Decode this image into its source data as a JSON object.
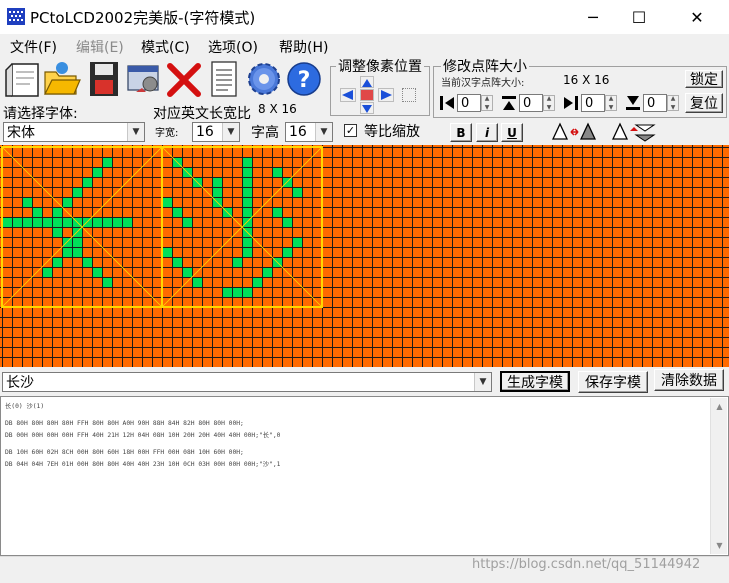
{
  "window": {
    "title": "PCtoLCD2002完美版-(字符模式)",
    "controls": {
      "minimize": "─",
      "maximize": "☐",
      "close": "✕"
    }
  },
  "menu": [
    {
      "label": "文件(F)",
      "enabled": true
    },
    {
      "label": "编辑(E)",
      "enabled": false
    },
    {
      "label": "模式(C)",
      "enabled": true
    },
    {
      "label": "选项(O)",
      "enabled": true
    },
    {
      "label": "帮助(H)",
      "enabled": true
    }
  ],
  "toolbar": {
    "icons": [
      "new-file-icon",
      "open-folder-icon",
      "save-disk-icon",
      "settings-window-icon",
      "delete-x-icon",
      "notepad-icon",
      "gear-icon",
      "help-icon"
    ]
  },
  "pixel_shift": {
    "title": "调整像素位置"
  },
  "matrix_size": {
    "title": "修改点阵大小",
    "current_label": "当前汉字点阵大小:",
    "current_value": "16 X 16",
    "lock_label": "锁定",
    "reset_label": "复位",
    "spinners": [
      "0",
      "0",
      "0",
      "0"
    ]
  },
  "font": {
    "select_label": "请选择字体:",
    "font_name": "宋体",
    "ratio_label": "对应英文长宽比",
    "ratio_value": "8 X 16",
    "width_label": "字宽:",
    "width_value": "16",
    "height_label": "字高",
    "height_value": "16",
    "proportional_label": "等比缩放",
    "proportional_checked": true,
    "bold_label": "B",
    "italic_label": "i",
    "underline_label": "U",
    "accent": "#ff6a00",
    "lit_color": "#00e05a",
    "frame_color": "#ffd800"
  },
  "input": {
    "text": "长沙",
    "generate_label": "生成字模",
    "save_label": "保存字模",
    "clear_label": "清除数据"
  },
  "output": {
    "lines": [
      "长(0) 沙(1)",
      "",
      "DB 80H 80H 80H 80H FFH 80H 80H A0H 90H 88H 84H 82H 80H 80H 00H;",
      "DB 00H 00H 00H 00H FFH 40H 21H 12H 04H 08H 10H 20H 20H 40H 40H 00H;\"长\",0",
      "",
      "DB 10H 60H 02H 8CH 00H 80H 60H 18H 00H FFH 00H 08H 10H 60H 00H;",
      "DB 04H 04H 7EH 01H 00H 80H 80H 40H 40H 23H 10H 0CH 03H 00H 00H 00H;\"沙\",1"
    ],
    "watermark": "https://blog.csdn.net/qq_51144942"
  }
}
